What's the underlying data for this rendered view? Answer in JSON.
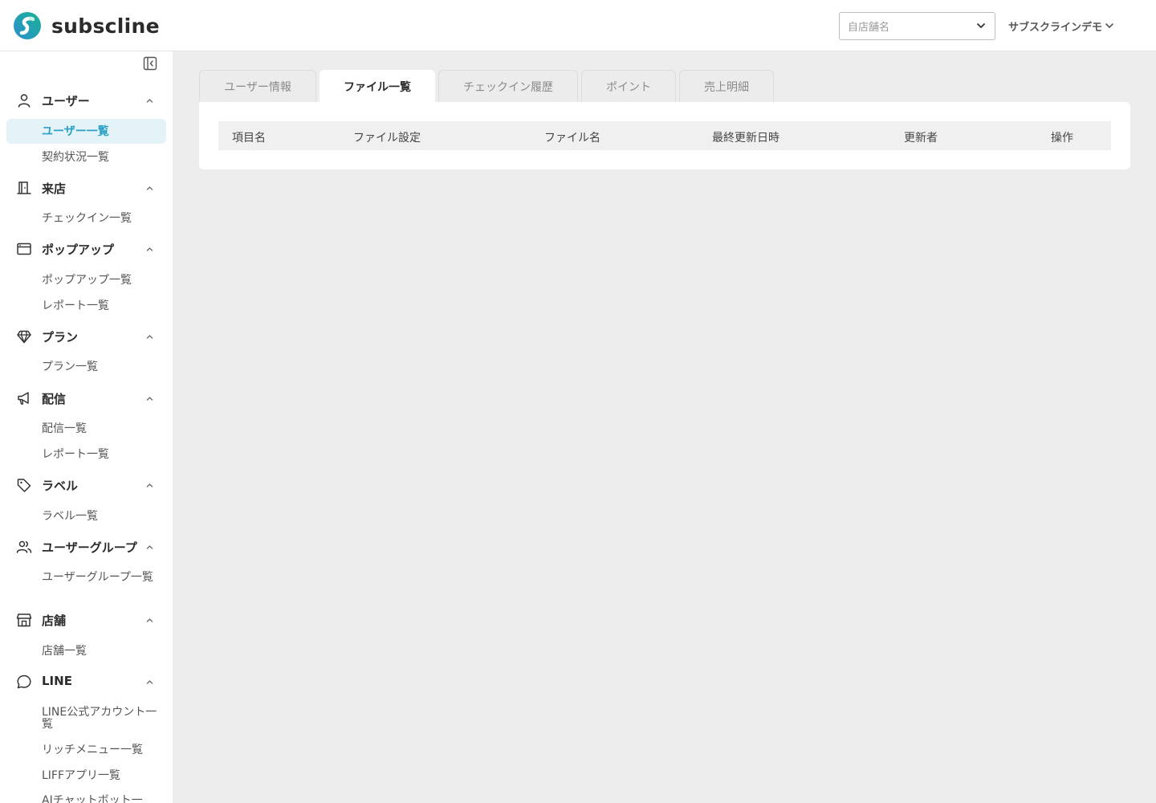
{
  "app": {
    "name": "subscline"
  },
  "header": {
    "store_placeholder": "自店舗名",
    "user_name": "サブスクラインデモ"
  },
  "sidebar": {
    "sections": [
      {
        "label": "ユーザー",
        "icon": "user-icon",
        "items": [
          "ユーザー一覧",
          "契約状況一覧"
        ]
      },
      {
        "label": "来店",
        "icon": "door-icon",
        "items": [
          "チェックイン一覧"
        ]
      },
      {
        "label": "ポップアップ",
        "icon": "browser-window-icon",
        "items": [
          "ポップアップ一覧",
          "レポート一覧"
        ]
      },
      {
        "label": "プラン",
        "icon": "diamond-icon",
        "items": [
          "プラン一覧"
        ]
      },
      {
        "label": "配信",
        "icon": "megaphone-icon",
        "items": [
          "配信一覧",
          "レポート一覧"
        ]
      },
      {
        "label": "ラベル",
        "icon": "tag-icon",
        "items": [
          "ラベル一覧"
        ]
      },
      {
        "label": "ユーザーグループ",
        "icon": "users-icon",
        "items": [
          "ユーザーグループ一覧"
        ]
      },
      {
        "label": "店舗",
        "icon": "store-icon",
        "items": [
          "店舗一覧"
        ]
      },
      {
        "label": "LINE",
        "icon": "chat-bubble-icon",
        "items": [
          "LINE公式アカウント一覧",
          "リッチメニュー一覧",
          "LIFFアプリ一覧",
          "AIチャットボット一"
        ]
      }
    ],
    "active_item": "ユーザー一覧"
  },
  "tabs": [
    {
      "label": "ユーザー情報",
      "active": false
    },
    {
      "label": "ファイル一覧",
      "active": true
    },
    {
      "label": "チェックイン履歴",
      "active": false
    },
    {
      "label": "ポイント",
      "active": false
    },
    {
      "label": "売上明細",
      "active": false
    }
  ],
  "table": {
    "columns": [
      "項目名",
      "ファイル設定",
      "ファイル名",
      "最終更新日時",
      "更新者",
      "操作"
    ],
    "rows": []
  },
  "colors": {
    "accent": "#2aa0c6",
    "active_bg": "#e3f3f8",
    "page_bg": "#ededed",
    "logo_teal": "#1ab394",
    "logo_blue": "#2a8fd0"
  }
}
